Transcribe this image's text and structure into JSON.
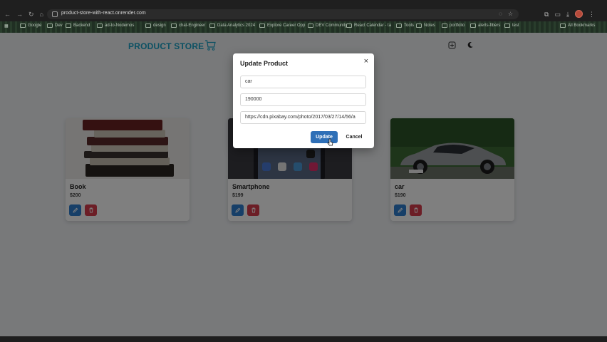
{
  "browser": {
    "url": "product-store-with-react.onrender.com",
    "bookmarks": [
      {
        "label": "Google"
      },
      {
        "label": "Dev"
      },
      {
        "label": "Backend"
      },
      {
        "label": "ad-to-Nodemos"
      },
      {
        "label": "design"
      },
      {
        "label": "chat-Engineer"
      },
      {
        "label": "Data Analytics 2024"
      },
      {
        "label": "Explore Career Opp"
      },
      {
        "label": "DEV Community"
      },
      {
        "label": "React Calendar - ta"
      },
      {
        "label": "Tools"
      },
      {
        "label": "Notes"
      },
      {
        "label": "portfolio"
      },
      {
        "label": "alerts-fibers"
      },
      {
        "label": "test"
      },
      {
        "label": "All Bookmarks"
      }
    ]
  },
  "header": {
    "brand": "PRODUCT STORE"
  },
  "products": [
    {
      "name": "Book",
      "price": "$200",
      "image_icon": "books-stack-image"
    },
    {
      "name": "Smartphone",
      "price": "$199",
      "image_icon": "smartphone-image"
    },
    {
      "name": "car",
      "price": "$190",
      "image_icon": "car-image"
    }
  ],
  "modal": {
    "title": "Update Product",
    "close_label": "×",
    "fields": {
      "name": "car",
      "price": "190000",
      "image": "https://cdn.pixabay.com/photo/2017/03/27/14/56/a"
    },
    "update_label": "Update",
    "cancel_label": "Cancel"
  },
  "colors": {
    "brand": "#1aa3c7",
    "update_button": "#2e6fb7",
    "edit_button": "#2f7fd1",
    "delete_button": "#d93c4c"
  }
}
